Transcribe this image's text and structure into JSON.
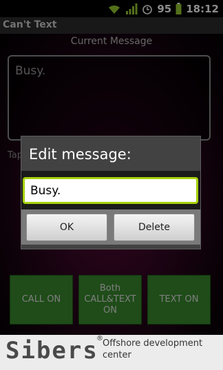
{
  "status_bar": {
    "battery": "95",
    "time": "18:12",
    "icons": [
      "wifi-icon",
      "signal-icon",
      "alarm-icon",
      "battery-icon"
    ]
  },
  "app": {
    "title": "Can't Text"
  },
  "main": {
    "current_label": "Current Message",
    "message": "Busy.",
    "tap_hint": "Tap"
  },
  "dialog": {
    "title": "Edit message:",
    "input_value": "Busy.",
    "ok_label": "OK",
    "delete_label": "Delete"
  },
  "bottom_buttons": [
    {
      "label": "CALL ON"
    },
    {
      "label": "Both\nCALL&TEXT\nON"
    },
    {
      "label": "TEXT ON"
    }
  ],
  "banner": {
    "logo": "Sibers",
    "reg": "®",
    "text": "Offshore development center"
  },
  "colors": {
    "accent_green": "#3a8a2e",
    "input_focus": "#a5d10a",
    "background": "#2e0620"
  }
}
